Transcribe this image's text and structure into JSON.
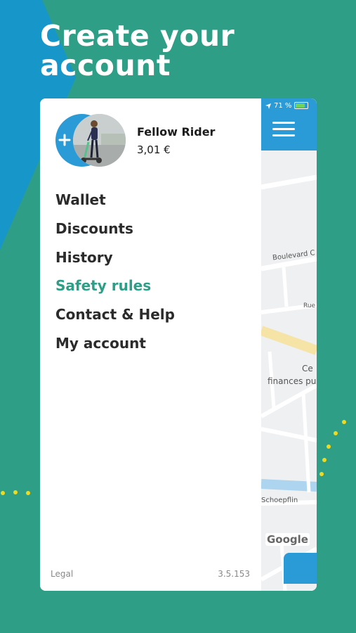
{
  "headline": {
    "line1": "Create your",
    "line2": "account"
  },
  "status_bar": {
    "battery": "71 %"
  },
  "user": {
    "name": "Fellow Rider",
    "balance": "3,01 €"
  },
  "menu": {
    "items": [
      {
        "label": "Wallet",
        "active": false
      },
      {
        "label": "Discounts",
        "active": false
      },
      {
        "label": "History",
        "active": false
      },
      {
        "label": "Safety rules",
        "active": true
      },
      {
        "label": "Contact & Help",
        "active": false
      },
      {
        "label": "My account",
        "active": false
      }
    ]
  },
  "footer": {
    "legal": "Legal",
    "version": "3.5.153"
  },
  "map": {
    "labels": {
      "boulevard": "Boulevard C",
      "rue": "Rue",
      "ce": "Ce",
      "finances": "finances pu",
      "schoepflin": "Schoepflin"
    },
    "attribution": "Google"
  },
  "icons": [
    "plus-icon",
    "hamburger-menu-icon",
    "location-arrow-icon",
    "battery-icon"
  ],
  "colors": {
    "background": "#2e9e87",
    "accent_blue": "#2a9bd6",
    "active_menu": "#2e9e87"
  }
}
